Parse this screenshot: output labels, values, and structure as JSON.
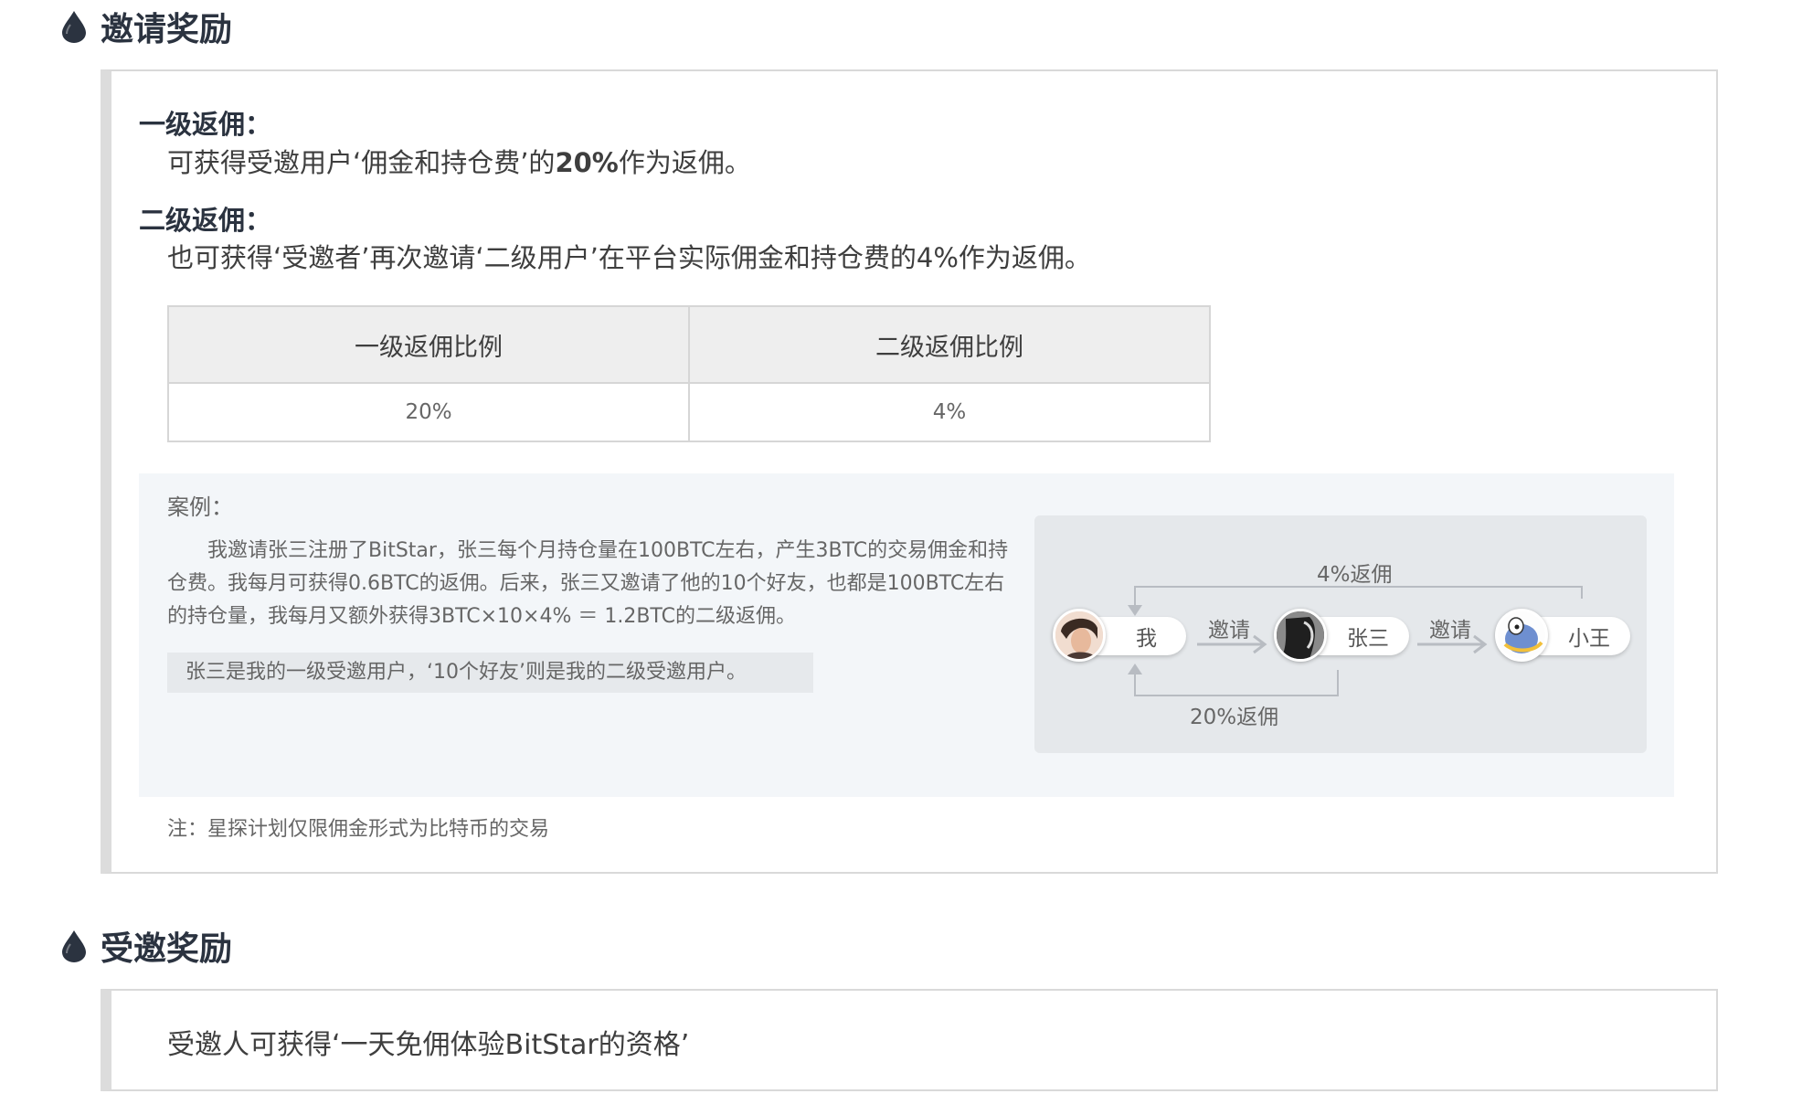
{
  "invite_reward": {
    "title": "邀请奖励",
    "level1": {
      "title": "一级返佣：",
      "desc_prefix": "可获得受邀用户‘佣金和持仓费’的",
      "desc_percent": "20%",
      "desc_suffix": "作为返佣。"
    },
    "level2": {
      "title": "二级返佣：",
      "desc": "也可获得‘受邀者’再次邀请‘二级用户’在平台实际佣金和持仓费的4%作为返佣。"
    },
    "table": {
      "headers": [
        "一级返佣比例",
        "二级返佣比例"
      ],
      "values": [
        "20%",
        "4%"
      ]
    },
    "case": {
      "label": "案例：",
      "paragraph": "我邀请张三注册了BitStar，张三每个月持仓量在100BTC左右，产生3BTC的交易佣金和持仓费。我每月可获得0.6BTC的返佣。后来，张三又邀请了他的10个好友，也都是100BTC左右的持仓量，我每月又额外获得3BTC×10×4% ＝ 1.2BTC的二级返佣。",
      "highlight": "张三是我的一级受邀用户，‘10个好友’则是我的二级受邀用户。",
      "diagram": {
        "top_label": "4%返佣",
        "bottom_label": "20%返佣",
        "invite_label": "邀请",
        "users": [
          "我",
          "张三",
          "小王"
        ]
      }
    },
    "note": "注：星探计划仅限佣金形式为比特币的交易"
  },
  "invitee_reward": {
    "title": "受邀奖励",
    "desc": "受邀人可获得‘一天免佣体验BitStar的资格’"
  },
  "colors": {
    "heading": "#2b3340",
    "panel_border": "#d9d9d9",
    "case_bg": "#f3f6f9",
    "diagram_bg": "#e5e8eb",
    "arrow": "#b8bcc2"
  }
}
